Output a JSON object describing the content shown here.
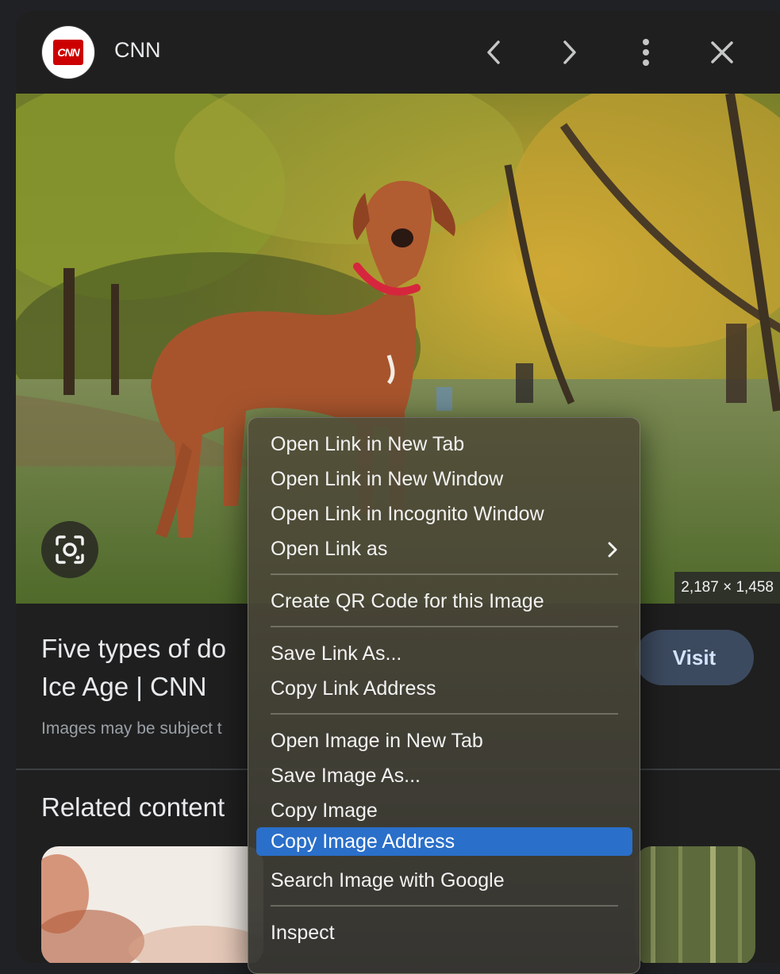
{
  "header": {
    "logo_text": "CNN",
    "source_name": "CNN",
    "prev_icon": "chevron-left-icon",
    "next_icon": "chevron-right-icon",
    "more_icon": "more-vert-icon",
    "close_icon": "close-icon"
  },
  "image": {
    "dimensions": "2,187 × 1,458",
    "lens_icon": "google-lens-icon"
  },
  "result": {
    "title_line1": "Five types of do",
    "title_line2": "Ice Age | CNN",
    "subtitle": "Images may be subject t",
    "visit_label": "Visit"
  },
  "related": {
    "heading": "Related content"
  },
  "context_menu": {
    "items": [
      {
        "label": "Open Link in New Tab"
      },
      {
        "label": "Open Link in New Window"
      },
      {
        "label": "Open Link in Incognito Window"
      },
      {
        "label": "Open Link as",
        "submenu": true
      },
      {
        "label": "Create QR Code for this Image"
      },
      {
        "label": "Save Link As..."
      },
      {
        "label": "Copy Link Address"
      },
      {
        "label": "Open Image in New Tab"
      },
      {
        "label": "Save Image As..."
      },
      {
        "label": "Copy Image"
      },
      {
        "label": "Copy Image Address",
        "highlighted": true
      },
      {
        "label": "Search Image with Google"
      },
      {
        "label": "Inspect"
      }
    ]
  },
  "colors": {
    "panel_bg": "#1f1f1f",
    "highlight": "#2a6fc9",
    "brand_red": "#cc0000"
  }
}
